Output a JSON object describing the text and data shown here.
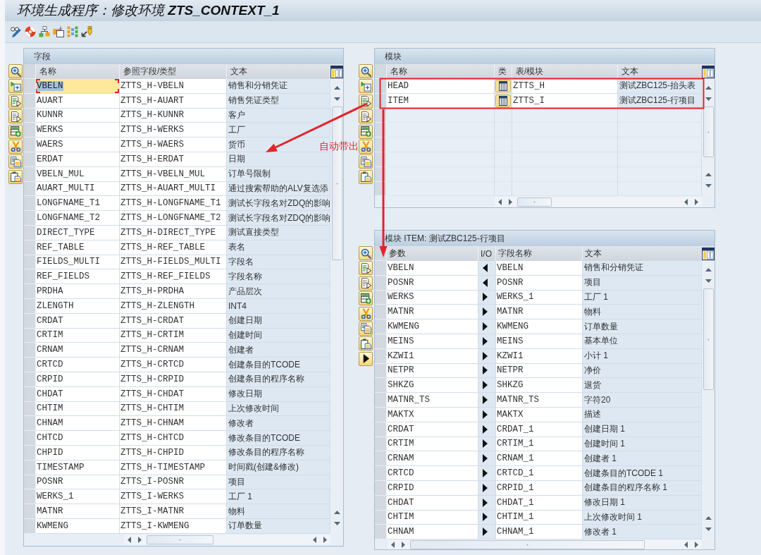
{
  "window": {
    "title": "环境生成程序：修改环境 **ZTS_CONTEXT_1**"
  },
  "fields_panel": {
    "title": "字段",
    "columns": [
      "名称",
      "参照字段/类型",
      "文本"
    ],
    "rows": [
      {
        "name": "VBELN",
        "reference": "ZTTS_H-VBELN",
        "text": "销售和分销凭证",
        "selected": true
      },
      {
        "name": "AUART",
        "reference": "ZTTS_H-AUART",
        "text": "销售凭证类型",
        "selected": false
      },
      {
        "name": "KUNNR",
        "reference": "ZTTS_H-KUNNR",
        "text": "客户",
        "selected": false
      },
      {
        "name": "WERKS",
        "reference": "ZTTS_H-WERKS",
        "text": "工厂",
        "selected": false
      },
      {
        "name": "WAERS",
        "reference": "ZTTS_H-WAERS",
        "text": "货币",
        "selected": false
      },
      {
        "name": "ERDAT",
        "reference": "ZTTS_H-ERDAT",
        "text": "日期",
        "selected": false
      },
      {
        "name": "VBELN_MUL",
        "reference": "ZTTS_H-VBELN_MUL",
        "text": "订单号限制",
        "selected": false
      },
      {
        "name": "AUART_MULTI",
        "reference": "ZTTS_H-AUART_MULTI",
        "text": "通过搜索帮助的ALV复选添",
        "selected": false
      },
      {
        "name": "LONGFNAME_T1",
        "reference": "ZTTS_H-LONGFNAME_T1",
        "text": "测试长字段名对ZDQ的影响",
        "selected": false
      },
      {
        "name": "LONGFNAME_T2",
        "reference": "ZTTS_H-LONGFNAME_T2",
        "text": "测试长字段名对ZDQ的影响",
        "selected": false
      },
      {
        "name": "DIRECT_TYPE",
        "reference": "ZTTS_H-DIRECT_TYPE",
        "text": "测试直接类型",
        "selected": false
      },
      {
        "name": "REF_TABLE",
        "reference": "ZTTS_H-REF_TABLE",
        "text": "表名",
        "selected": false
      },
      {
        "name": "FIELDS_MULTI",
        "reference": "ZTTS_H-FIELDS_MULTI",
        "text": "字段名",
        "selected": false
      },
      {
        "name": "REF_FIELDS",
        "reference": "ZTTS_H-REF_FIELDS",
        "text": "字段名称",
        "selected": false
      },
      {
        "name": "PRDHA",
        "reference": "ZTTS_H-PRDHA",
        "text": "产品层次",
        "selected": false
      },
      {
        "name": "ZLENGTH",
        "reference": "ZTTS_H-ZLENGTH",
        "text": "INT4",
        "selected": false
      },
      {
        "name": "CRDAT",
        "reference": "ZTTS_H-CRDAT",
        "text": "创建日期",
        "selected": false
      },
      {
        "name": "CRTIM",
        "reference": "ZTTS_H-CRTIM",
        "text": "创建时间",
        "selected": false
      },
      {
        "name": "CRNAM",
        "reference": "ZTTS_H-CRNAM",
        "text": "创建者",
        "selected": false
      },
      {
        "name": "CRTCD",
        "reference": "ZTTS_H-CRTCD",
        "text": "创建条目的TCODE",
        "selected": false
      },
      {
        "name": "CRPID",
        "reference": "ZTTS_H-CRPID",
        "text": "创建条目的程序名称",
        "selected": false
      },
      {
        "name": "CHDAT",
        "reference": "ZTTS_H-CHDAT",
        "text": "修改日期",
        "selected": false
      },
      {
        "name": "CHTIM",
        "reference": "ZTTS_H-CHTIM",
        "text": "上次修改时间",
        "selected": false
      },
      {
        "name": "CHNAM",
        "reference": "ZTTS_H-CHNAM",
        "text": "修改者",
        "selected": false
      },
      {
        "name": "CHTCD",
        "reference": "ZTTS_H-CHTCD",
        "text": "修改条目的TCODE",
        "selected": false
      },
      {
        "name": "CHPID",
        "reference": "ZTTS_H-CHPID",
        "text": "修改条目的程序名称",
        "selected": false
      },
      {
        "name": "TIMESTAMP",
        "reference": "ZTTS_H-TIMESTAMP",
        "text": "时间戳(创建&修改)",
        "selected": false
      },
      {
        "name": "POSNR",
        "reference": "ZTTS_I-POSNR",
        "text": "项目",
        "selected": false
      },
      {
        "name": "WERKS_1",
        "reference": "ZTTS_I-WERKS",
        "text": "工厂 1",
        "selected": false
      },
      {
        "name": "MATNR",
        "reference": "ZTTS_I-MATNR",
        "text": "物料",
        "selected": false
      },
      {
        "name": "KWMENG",
        "reference": "ZTTS_I-KWMENG",
        "text": "订单数量",
        "selected": false
      }
    ]
  },
  "modules_panel": {
    "title": "模块",
    "columns": [
      "名称",
      "类",
      "表/模块",
      "文本"
    ],
    "rows": [
      {
        "name": "HEAD",
        "table": "ZTTS_H",
        "text": "测试ZBC125-抬头表"
      },
      {
        "name": "ITEM",
        "table": "ZTTS_I",
        "text": "测试ZBC125-行项目"
      }
    ]
  },
  "module_detail_panel": {
    "title": "模块 ITEM: 测试ZBC125-行项目",
    "columns": [
      "参数",
      "I/O",
      "字段名称",
      "文本"
    ],
    "rows": [
      {
        "parameter": "VBELN",
        "kind": "left",
        "field": "VBELN",
        "text": "销售和分销凭证"
      },
      {
        "parameter": "POSNR",
        "kind": "left",
        "field": "POSNR",
        "text": "项目"
      },
      {
        "parameter": "WERKS",
        "kind": "right",
        "field": "WERKS_1",
        "text": "工厂 1"
      },
      {
        "parameter": "MATNR",
        "kind": "right",
        "field": "MATNR",
        "text": "物料"
      },
      {
        "parameter": "KWMENG",
        "kind": "right",
        "field": "KWMENG",
        "text": "订单数量"
      },
      {
        "parameter": "MEINS",
        "kind": "right",
        "field": "MEINS",
        "text": "基本单位"
      },
      {
        "parameter": "KZWI1",
        "kind": "right",
        "field": "KZWI1",
        "text": "小计 1"
      },
      {
        "parameter": "NETPR",
        "kind": "right",
        "field": "NETPR",
        "text": "净价"
      },
      {
        "parameter": "SHKZG",
        "kind": "right",
        "field": "SHKZG",
        "text": "退货"
      },
      {
        "parameter": "MATNR_TS",
        "kind": "right",
        "field": "MATNR_TS",
        "text": "字符20"
      },
      {
        "parameter": "MAKTX",
        "kind": "right",
        "field": "MAKTX",
        "text": "描述"
      },
      {
        "parameter": "CRDAT",
        "kind": "right",
        "field": "CRDAT_1",
        "text": "创建日期 1"
      },
      {
        "parameter": "CRTIM",
        "kind": "right",
        "field": "CRTIM_1",
        "text": "创建时间 1"
      },
      {
        "parameter": "CRNAM",
        "kind": "right",
        "field": "CRNAM_1",
        "text": "创建者 1"
      },
      {
        "parameter": "CRTCD",
        "kind": "right",
        "field": "CRTCD_1",
        "text": "创建条目的TCODE 1"
      },
      {
        "parameter": "CRPID",
        "kind": "right",
        "field": "CRPID_1",
        "text": "创建条目的程序名称 1"
      },
      {
        "parameter": "CHDAT",
        "kind": "right",
        "field": "CHDAT_1",
        "text": "修改日期 1"
      },
      {
        "parameter": "CHTIM",
        "kind": "right",
        "field": "CHTIM_1",
        "text": "上次修改时间 1"
      },
      {
        "parameter": "CHNAM",
        "kind": "right",
        "field": "CHNAM_1",
        "text": "修改者 1"
      }
    ]
  },
  "annotation": {
    "label": "自动带出"
  }
}
